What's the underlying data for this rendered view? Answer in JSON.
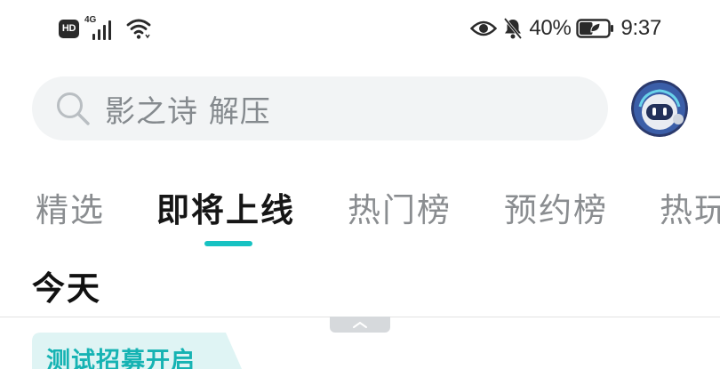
{
  "status_bar": {
    "hd_label": "HD",
    "network_label": "4G",
    "battery_percent": "40%",
    "time": "9:37",
    "icons": [
      "hd-icon",
      "signal-icon",
      "wifi-icon",
      "eye-icon",
      "bell-muted-icon",
      "battery-icon"
    ]
  },
  "search": {
    "icon": "search-icon",
    "text": "影之诗 解压"
  },
  "avatar": {
    "icon": "robot-avatar"
  },
  "tabs": [
    {
      "label": "精选",
      "active": false
    },
    {
      "label": "即将上线",
      "active": true
    },
    {
      "label": "热门榜",
      "active": false
    },
    {
      "label": "预约榜",
      "active": false
    },
    {
      "label": "热玩",
      "active": false
    }
  ],
  "section": {
    "title": "今天",
    "badge": "测试招募开启"
  },
  "colors": {
    "accent": "#17c2c2",
    "badge_bg": "#dff4f4",
    "search_bg": "#f2f4f5"
  }
}
